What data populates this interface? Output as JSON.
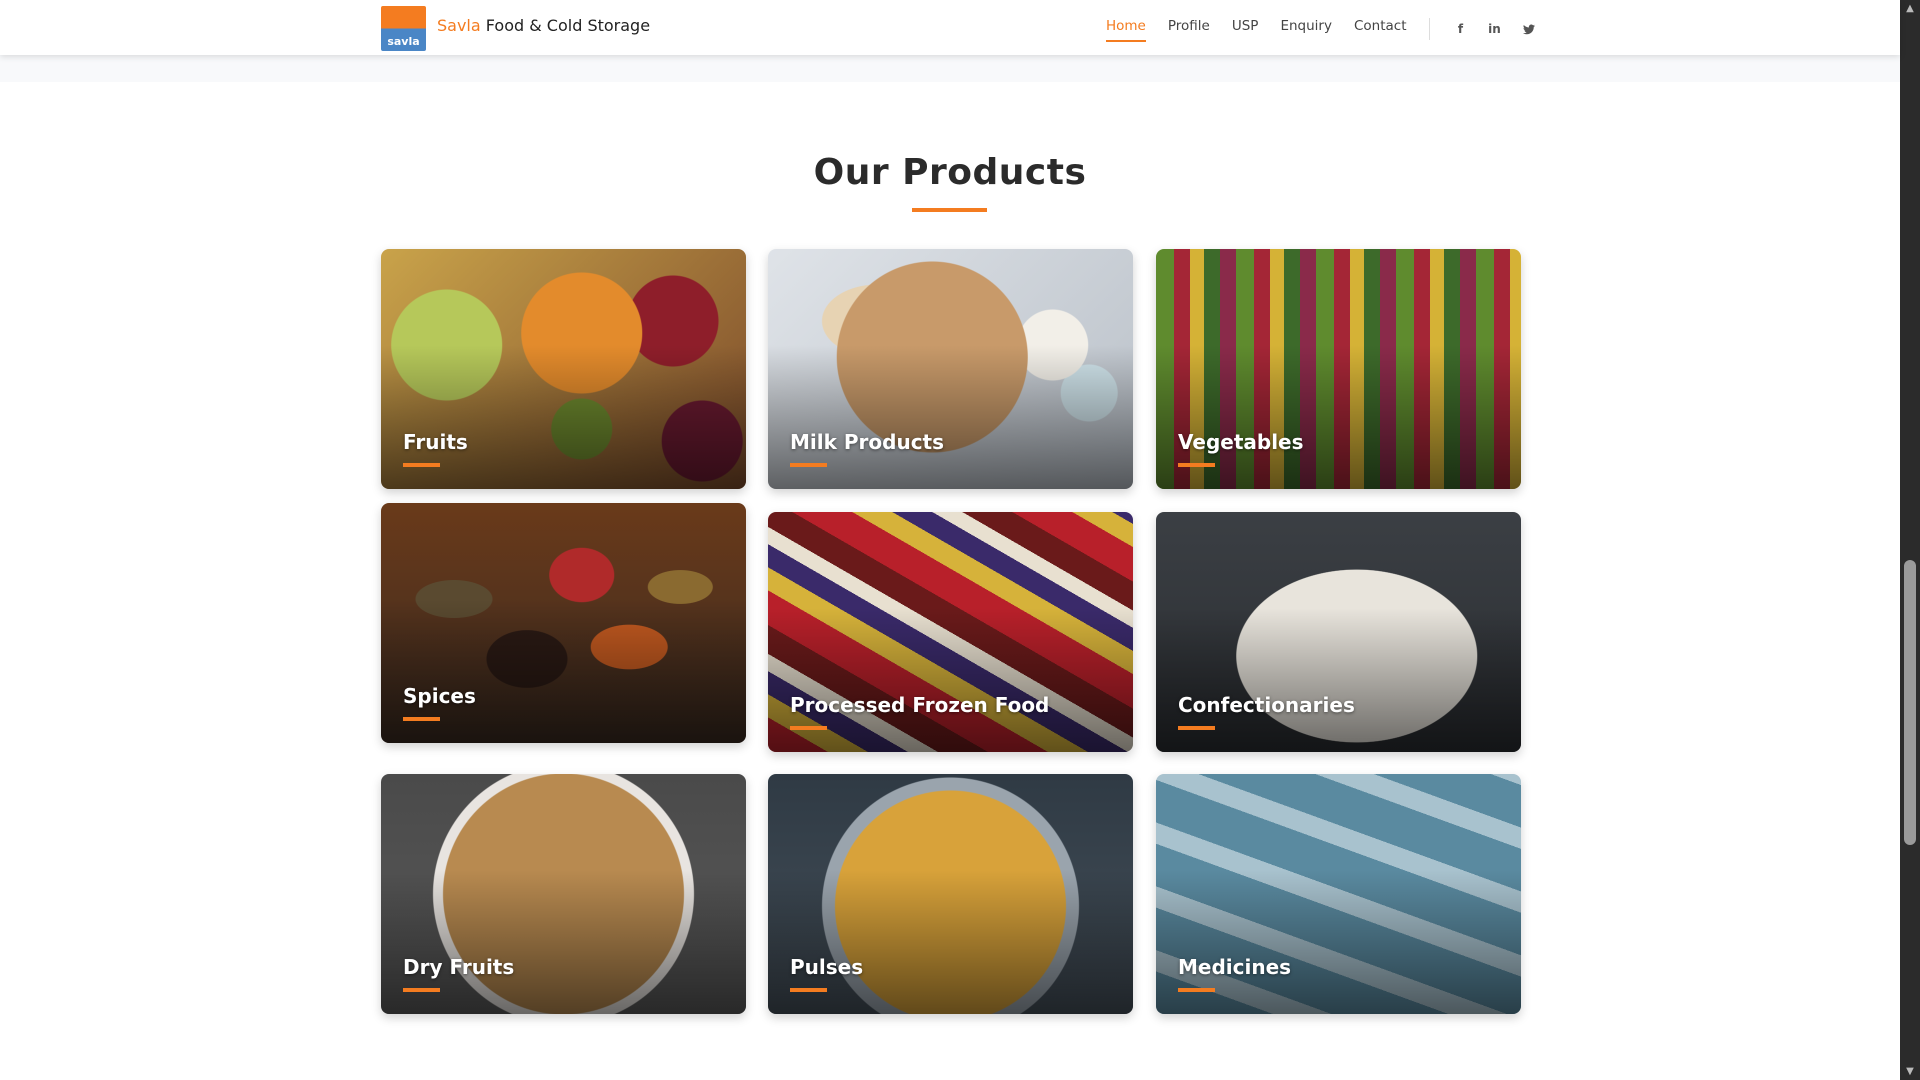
{
  "header": {
    "logo_text": "savla",
    "brand_accent": "Savla",
    "brand_rest": " Food & Cold Storage",
    "nav": [
      {
        "label": "Home",
        "active": true
      },
      {
        "label": "Profile"
      },
      {
        "label": "USP"
      },
      {
        "label": "Enquiry"
      },
      {
        "label": "Contact"
      }
    ],
    "social": [
      {
        "icon": "facebook-icon",
        "glyph": "f"
      },
      {
        "icon": "linkedin-icon",
        "glyph": "in"
      },
      {
        "icon": "twitter-icon",
        "glyph": "✦"
      }
    ]
  },
  "section": {
    "title": "Our Products"
  },
  "products": [
    {
      "label": "Fruits"
    },
    {
      "label": "Milk Products"
    },
    {
      "label": "Vegetables"
    },
    {
      "label": "Spices"
    },
    {
      "label": "Processed Frozen Food"
    },
    {
      "label": "Confectionaries"
    },
    {
      "label": "Dry Fruits"
    },
    {
      "label": "Pulses"
    },
    {
      "label": "Medicines"
    }
  ],
  "colors": {
    "accent": "#f47c20",
    "logo_blue": "#4a86c6",
    "heading": "#2b2b2b"
  }
}
